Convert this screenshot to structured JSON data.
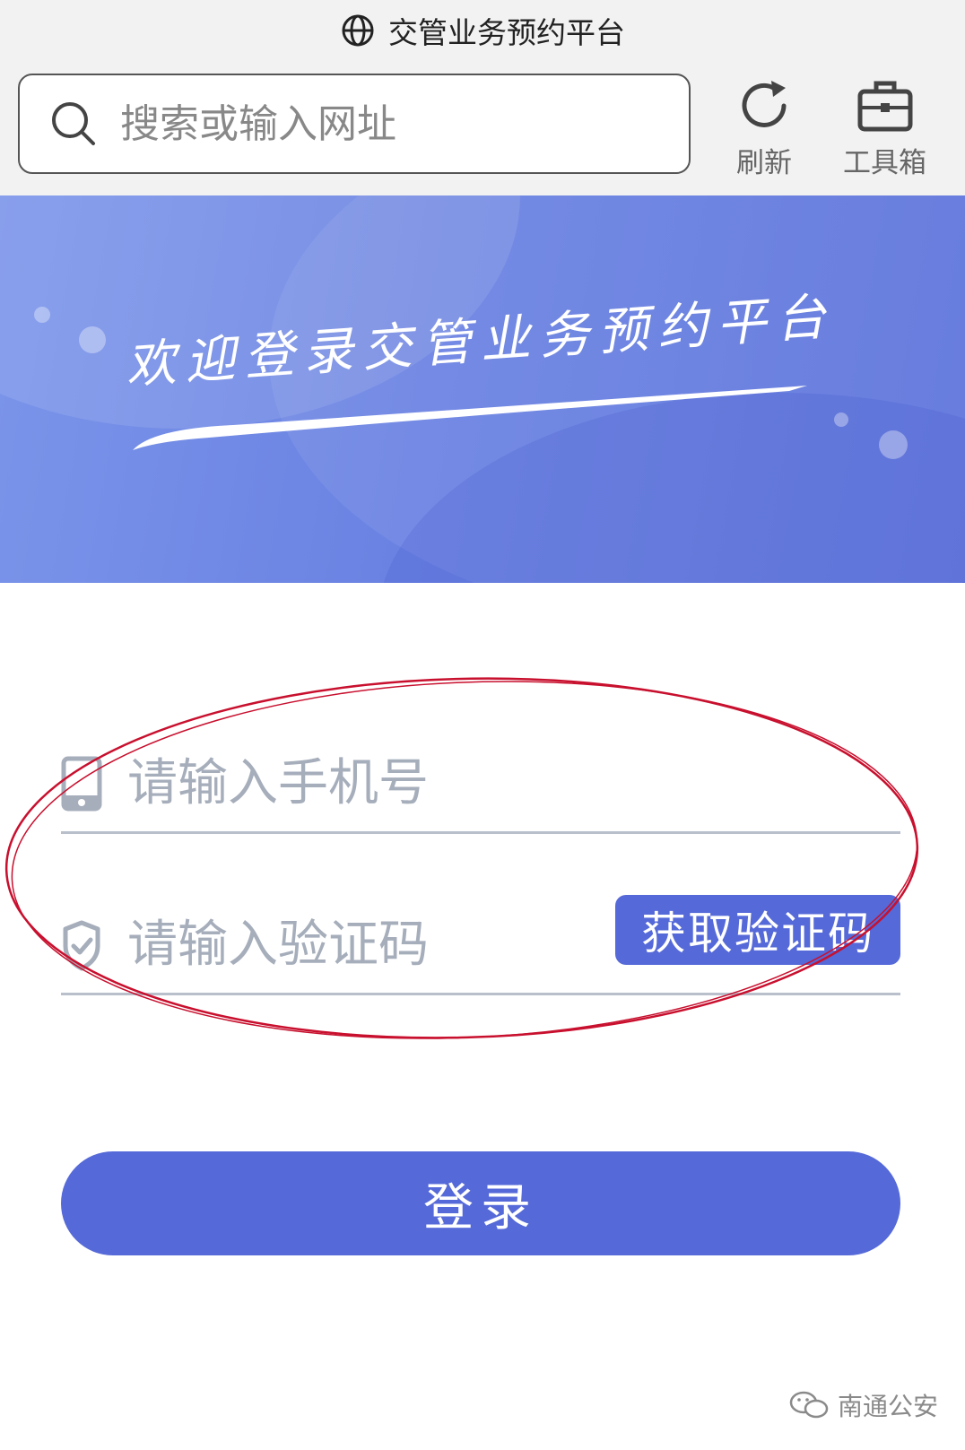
{
  "browser": {
    "title": "交管业务预约平台",
    "search_placeholder": "搜索或输入网址",
    "refresh_label": "刷新",
    "toolbox_label": "工具箱"
  },
  "banner": {
    "welcome_text": "欢迎登录交管业务预约平台"
  },
  "form": {
    "phone_placeholder": "请输入手机号",
    "code_placeholder": "请输入验证码",
    "get_code_label": "获取验证码",
    "login_label": "登录"
  },
  "watermark": {
    "text": "南通公安"
  },
  "colors": {
    "accent": "#5569d8",
    "banner": "#6a82e2",
    "annotation": "#c8102e"
  }
}
